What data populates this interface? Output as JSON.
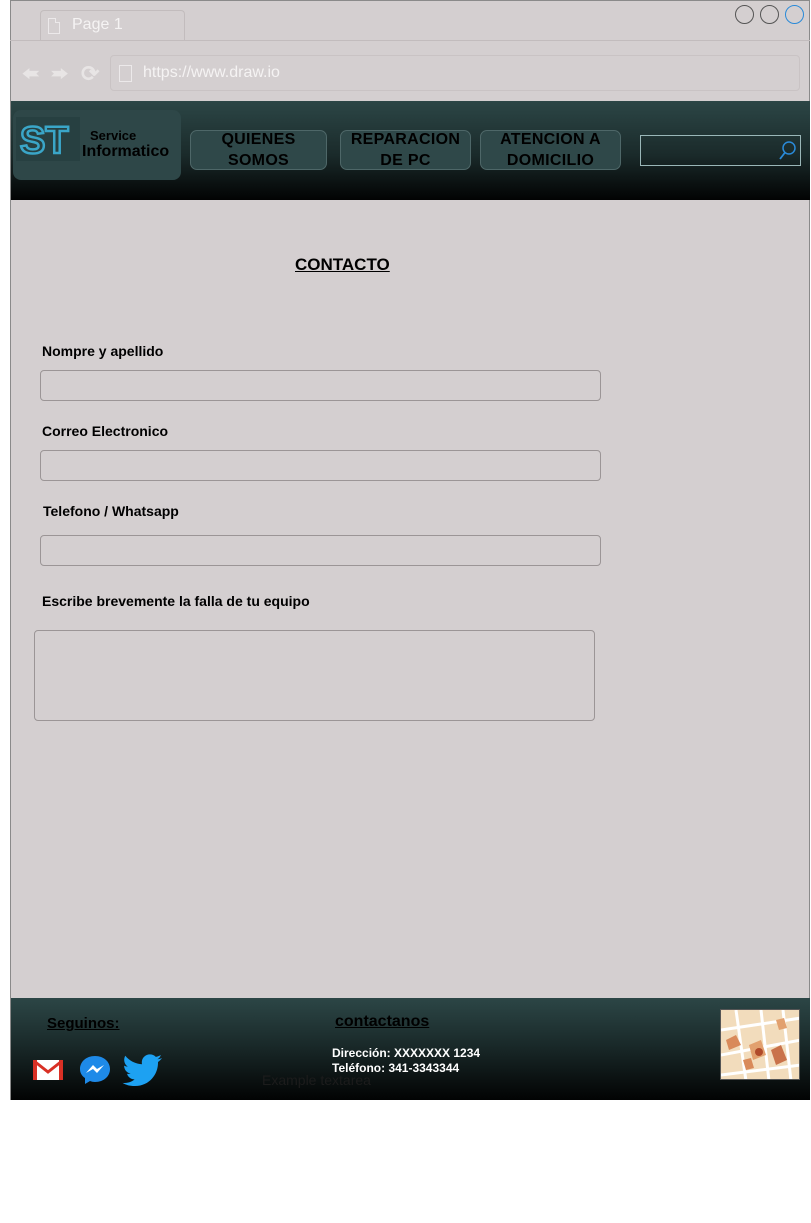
{
  "browser": {
    "tab_label": "Page 1",
    "url": "https://www.draw.io"
  },
  "header": {
    "logo_mark": "ST",
    "logo_top": "Service",
    "logo_bottom": "Informatico",
    "nav": [
      {
        "line1": "QUIENES",
        "line2": "SOMOS"
      },
      {
        "line1": "REPARACION",
        "line2": "DE PC"
      },
      {
        "line1": "ATENCION A",
        "line2": "DOMICILIO"
      }
    ],
    "search_value": ""
  },
  "form": {
    "title": "CONTACTO",
    "fields": [
      {
        "label": "Nompre y apellido",
        "value": ""
      },
      {
        "label": "Correo Electronico",
        "value": ""
      },
      {
        "label": "Telefono / Whatsapp",
        "value": ""
      },
      {
        "label": "Escribe brevemente la falla de tu equipo",
        "value": ""
      }
    ]
  },
  "footer": {
    "follow_label": "Seguinos:",
    "contact_title": "contactanos",
    "address": "Dirección: XXXXXXX 1234",
    "phone": "Teléfono: 341-3343344",
    "textarea_placeholder": "Example textarea",
    "social": [
      "gmail-icon",
      "messenger-icon",
      "twitter-icon"
    ]
  },
  "colors": {
    "background": "#d4cfd0",
    "header_top": "#2c4646",
    "header_bottom": "#020303",
    "logo_accent": "#3aa6c8",
    "window_button_active": "#2a8ad8"
  }
}
